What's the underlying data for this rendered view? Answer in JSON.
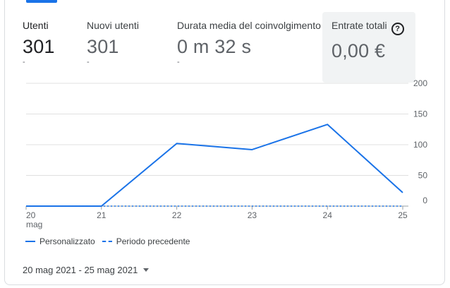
{
  "metrics": [
    {
      "label": "Utenti",
      "value": "301",
      "sub": "-"
    },
    {
      "label": "Nuovi utenti",
      "value": "301",
      "sub": "-"
    },
    {
      "label": "Durata media del coinvolgimento",
      "value": "0 m 32 s",
      "sub": "-"
    },
    {
      "label": "Entrate totali",
      "value": "0,00 €",
      "help": "?"
    }
  ],
  "legend": {
    "current": "Personalizzato",
    "previous": "Periodo precedente"
  },
  "date_range": "20 mag 2021 - 25 mag 2021",
  "colors": {
    "accent": "#1a73e8",
    "grid": "#e0e0e0"
  },
  "chart_data": {
    "type": "line",
    "categories": [
      "20",
      "21",
      "22",
      "23",
      "24",
      "25"
    ],
    "first_month_label": "mag",
    "y_ticks": [
      0,
      50,
      100,
      150,
      200
    ],
    "ylim": [
      0,
      200
    ],
    "series": [
      {
        "name": "Personalizzato",
        "values": [
          0,
          0,
          102,
          92,
          133,
          22
        ]
      },
      {
        "name": "Periodo precedente",
        "values": [
          0,
          0,
          0,
          0,
          0,
          0
        ]
      }
    ]
  }
}
